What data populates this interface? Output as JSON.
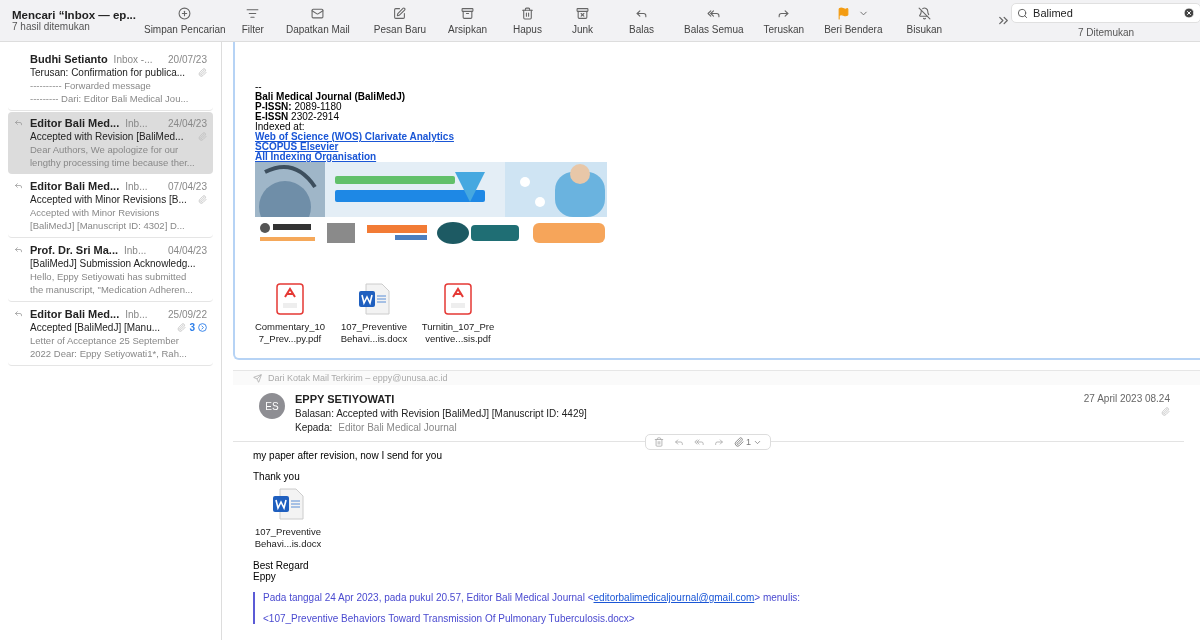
{
  "window": {
    "title": "Mencari “Inbox — ep...",
    "subtitle": "7 hasil ditemukan"
  },
  "toolbar": [
    {
      "label": "Simpan Pencarian"
    },
    {
      "label": "Filter"
    },
    {
      "label": "Dapatkan Mail"
    },
    {
      "label": "Pesan Baru"
    },
    {
      "label": "Arsipkan"
    },
    {
      "label": "Hapus"
    },
    {
      "label": "Junk"
    },
    {
      "label": "Balas"
    },
    {
      "label": "Balas Semua"
    },
    {
      "label": "Teruskan"
    },
    {
      "label": "Beri Bendera"
    },
    {
      "label": "Bisukan"
    }
  ],
  "search": {
    "value": "Balimed",
    "result": "7 Ditemukan"
  },
  "messages": [
    {
      "sender": "Budhi Setianto",
      "mailbox": "Inbox -...",
      "date": "20/07/23",
      "subject": "Terusan: Confirmation for publica...",
      "preview": [
        "---------- Forwarded message",
        "--------- Dari: Editor Bali Medical Jou..."
      ],
      "selected": false,
      "replied": false,
      "attachment": true
    },
    {
      "sender": "Editor Bali Med...",
      "mailbox": "Inb...",
      "date": "24/04/23",
      "subject": "Accepted with Revision [BaliMed...",
      "preview": [
        "Dear Authors,   We apologize for our",
        "lengthy processing time because ther..."
      ],
      "selected": true,
      "replied": true,
      "attachment": true
    },
    {
      "sender": "Editor Bali Med...",
      "mailbox": "Inb...",
      "date": "07/04/23",
      "subject": "Accepted with Minor Revisions [B...",
      "preview": [
        "Accepted with Minor Revisions",
        "[BaliMedJ] [Manuscript ID: 4302]   D..."
      ],
      "selected": false,
      "replied": true,
      "attachment": true
    },
    {
      "sender": "Prof. Dr. Sri Ma...",
      "mailbox": "Inb...",
      "date": "04/04/23",
      "subject": "[BaliMedJ] Submission Acknowledg...",
      "preview": [
        "Hello, Eppy Setiyowati has submitted",
        "the manuscript, \"Medication Adheren..."
      ],
      "selected": false,
      "replied": true,
      "attachment": false
    },
    {
      "sender": "Editor Bali Med...",
      "mailbox": "Inb...",
      "date": "25/09/22",
      "subject": "Accepted [BaliMedJ] [Manu...",
      "preview": [
        "Letter of Acceptance 25 September",
        "2022     Dear: Eppy Setiyowati1*, Rah..."
      ],
      "selected": false,
      "replied": true,
      "attachment": true,
      "thread_count": "3"
    }
  ],
  "first_email": {
    "signature": [
      "--",
      "**Bali Medical Journal (BaliMedJ)**",
      "**P-ISSN:** 2089-1180",
      "**E-ISSN** 2302-2914",
      "Indexed at:"
    ],
    "links": [
      "Web of Science (WOS) Clarivate Analytics",
      "SCOPUS Elsevier",
      "All Indexing Organisation"
    ],
    "attachments": [
      {
        "kind": "pdf",
        "name": [
          "Commentary_10",
          "7_Prev...py.pdf"
        ]
      },
      {
        "kind": "word",
        "name": [
          "107_Preventive",
          "Behavi...is.docx"
        ]
      },
      {
        "kind": "pdf",
        "name": [
          "Turnitin_107_Pre",
          "ventive...sis.pdf"
        ]
      }
    ]
  },
  "second_email": {
    "origin": "Dari Kotak Mail Terkirim – eppy@unusa.ac.id",
    "avatar": "ES",
    "sender": "EPPY SETIYOWATI",
    "subject": "Balasan: Accepted with Revision [BaliMedJ] [Manuscript ID: 4429]",
    "to_label": "Kepada:",
    "to": "Editor Bali Medical Journal",
    "date": "27 April 2023 08.24",
    "attachment_count": "1",
    "body": [
      "my paper after revision, now I send for you",
      "Thank you"
    ],
    "attachments": [
      {
        "kind": "word",
        "name": [
          "107_Preventive",
          "Behavi...is.docx"
        ]
      }
    ],
    "closing": [
      "Best Regard",
      "Eppy"
    ],
    "quote": {
      "intro": "Pada tanggal 24 Apr 2023, pada pukul 20.57, Editor Bali Medical Journal <",
      "email": "editorbalimedicaljournal@gmail.com",
      "outro": "> menulis:",
      "line": "<107_Preventive Behaviors Toward Transmission Of Pulmonary Tuberculosis.docx>"
    }
  }
}
